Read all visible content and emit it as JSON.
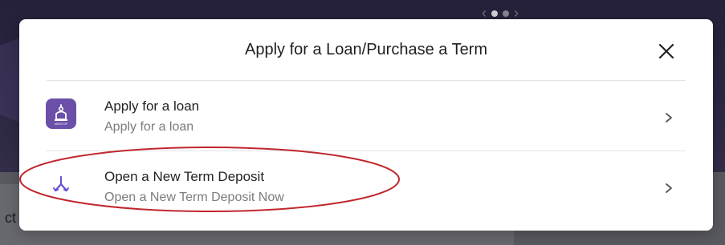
{
  "background": {
    "partial_text": "ct"
  },
  "modal": {
    "title": "Apply for a Loan/Purchase a Term",
    "close_icon": "close-icon"
  },
  "options": [
    {
      "title": "Apply for a loan",
      "subtitle": "Apply for a loan",
      "icon": "bank-building-icon",
      "icon_label": "MIDSTOP",
      "icon_color": "#6b4fa8"
    },
    {
      "title": "Open a New Term Deposit",
      "subtitle": "Open a New Term Deposit Now",
      "icon": "split-arrows-icon",
      "icon_color": "#6b4fd0"
    }
  ],
  "annotation": {
    "color": "#c0272d",
    "target": "Open a New Term Deposit"
  }
}
